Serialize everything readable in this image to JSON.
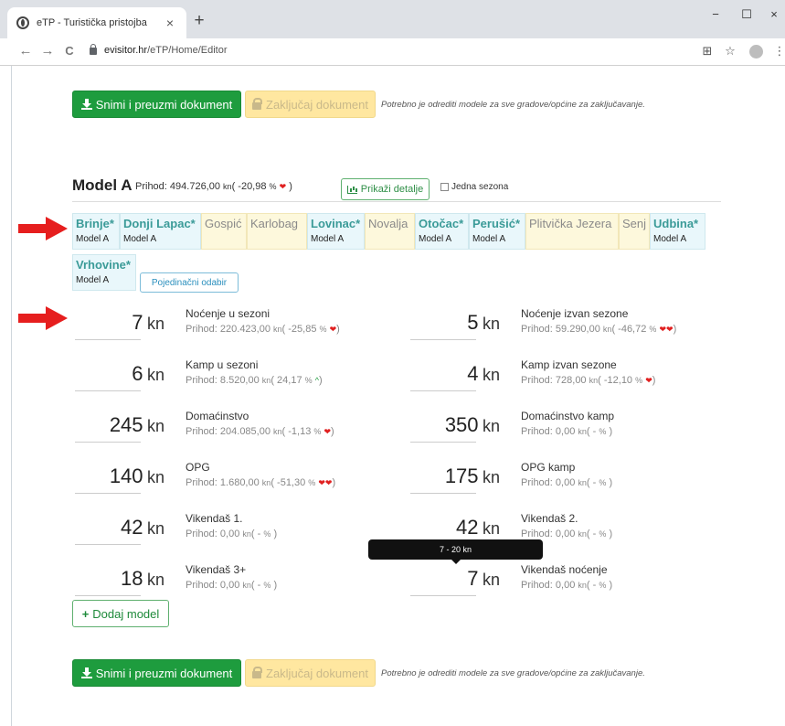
{
  "browser": {
    "tab_title": "eTP - Turistička pristojba",
    "tab_close": "×",
    "new_tab": "+",
    "url_domain": "evisitor.hr",
    "url_path": "/eTP/Home/Editor",
    "back": "←",
    "forward": "→",
    "reload": "C",
    "minimize": "−",
    "maximize": "☐",
    "close": "×",
    "translate": "⊞",
    "bookmark": "☆",
    "menu": "⋮"
  },
  "toolbar": {
    "save_label": "Snimi i preuzmi dokument",
    "lock_label": "Zaključaj dokument",
    "note": "Potrebno je odrediti modele za sve gradove/općine za zaključavanje."
  },
  "model": {
    "title": "Model A",
    "prihod_label": "Prihod:",
    "prihod_value": "494.726,00",
    "unit": "kn",
    "change": "( -20,98",
    "pct": "%",
    "trend": "❤",
    "close": ")",
    "details_label": "Prikaži detalje",
    "single_season_label": "Jedna sezona"
  },
  "cities": [
    {
      "name": "Brinje*",
      "model": "Model A"
    },
    {
      "name": "Donji Lapac*",
      "model": "Model A"
    },
    {
      "name": "Gospić",
      "model": ""
    },
    {
      "name": "Karlobag",
      "model": ""
    },
    {
      "name": "Lovinac*",
      "model": "Model A"
    },
    {
      "name": "Novalja",
      "model": ""
    },
    {
      "name": "Otočac*",
      "model": "Model A"
    },
    {
      "name": "Perušić*",
      "model": "Model A"
    },
    {
      "name": "Plitvička Jezera",
      "model": ""
    },
    {
      "name": "Senj",
      "model": ""
    },
    {
      "name": "Udbina*",
      "model": "Model A"
    },
    {
      "name": "Vrhovine*",
      "model": "Model A"
    }
  ],
  "individual_select_label": "Pojedinačni odabir",
  "items": [
    {
      "price": "7",
      "unit": "kn",
      "name": "Noćenje u sezoni",
      "prihod": "Prihod: 220.423,00",
      "kn": "kn",
      "change": "( -25,85",
      "pct": "%",
      "trend": "❤",
      "close": ")"
    },
    {
      "price": "5",
      "unit": "kn",
      "name": "Noćenje izvan sezone",
      "prihod": "Prihod: 59.290,00",
      "kn": "kn",
      "change": "( -46,72",
      "pct": "%",
      "trend": "❤❤",
      "close": ")"
    },
    {
      "price": "6",
      "unit": "kn",
      "name": "Kamp u sezoni",
      "prihod": "Prihod: 8.520,00",
      "kn": "kn",
      "change": "( 24,17",
      "pct": "%",
      "trend": "^",
      "close": ")"
    },
    {
      "price": "4",
      "unit": "kn",
      "name": "Kamp izvan sezone",
      "prihod": "Prihod: 728,00",
      "kn": "kn",
      "change": "( -12,10",
      "pct": "%",
      "trend": "❤",
      "close": ")"
    },
    {
      "price": "245",
      "unit": "kn",
      "name": "Domaćinstvo",
      "prihod": "Prihod: 204.085,00",
      "kn": "kn",
      "change": "( -1,13",
      "pct": "%",
      "trend": "❤",
      "close": ")"
    },
    {
      "price": "350",
      "unit": "kn",
      "name": "Domaćinstvo kamp",
      "prihod": "Prihod: 0,00",
      "kn": "kn",
      "change": "( -",
      "pct": "%",
      "trend": "",
      "close": ")"
    },
    {
      "price": "140",
      "unit": "kn",
      "name": "OPG",
      "prihod": "Prihod: 1.680,00",
      "kn": "kn",
      "change": "( -51,30",
      "pct": "%",
      "trend": "❤❤",
      "close": ")"
    },
    {
      "price": "175",
      "unit": "kn",
      "name": "OPG kamp",
      "prihod": "Prihod: 0,00",
      "kn": "kn",
      "change": "( -",
      "pct": "%",
      "trend": "",
      "close": ")"
    },
    {
      "price": "42",
      "unit": "kn",
      "name": "Vikendaš 1.",
      "prihod": "Prihod: 0,00",
      "kn": "kn",
      "change": "( -",
      "pct": "%",
      "trend": "",
      "close": ")"
    },
    {
      "price": "42",
      "unit": "kn",
      "name": "Vikendaš 2.",
      "prihod": "Prihod: 0,00",
      "kn": "kn",
      "change": "( -",
      "pct": "%",
      "trend": "",
      "close": ")"
    },
    {
      "price": "18",
      "unit": "kn",
      "name": "Vikendaš 3+",
      "prihod": "Prihod: 0,00",
      "kn": "kn",
      "change": "( -",
      "pct": "%",
      "trend": "",
      "close": ")"
    },
    {
      "price": "7",
      "unit": "kn",
      "name": "Vikendaš noćenje",
      "prihod": "Prihod: 0,00",
      "kn": "kn",
      "change": "( -",
      "pct": "%",
      "trend": "",
      "close": ")"
    }
  ],
  "tooltip": "7 - 20 kn",
  "add_model_label": "Dodaj model",
  "colors": {
    "green": "#1e9c3e",
    "yellow": "#ffe7a0",
    "teal": "#3b9b98",
    "red": "#e61e1e"
  }
}
